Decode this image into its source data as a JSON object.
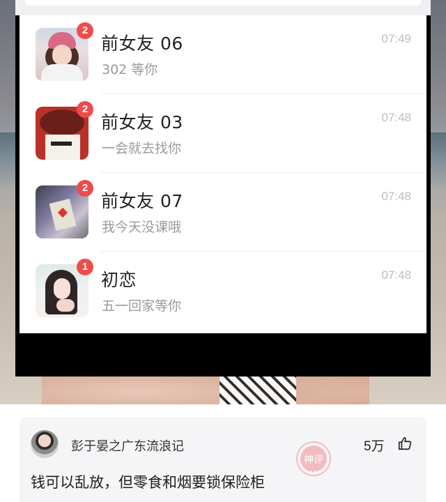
{
  "chat_list": {
    "items": [
      {
        "name": "前女友 06",
        "message": "302 等你",
        "time": "07:49",
        "unread": "2",
        "avatar_icon": "girl-pink-hat-avatar"
      },
      {
        "name": "前女友 03",
        "message": "一会就去找你",
        "time": "07:48",
        "unread": "2",
        "avatar_icon": "red-hat-avatar"
      },
      {
        "name": "前女友 07",
        "message": "我今天没课哦",
        "time": "07:48",
        "unread": "2",
        "avatar_icon": "card-heart-avatar"
      },
      {
        "name": "初恋",
        "message": "五一回家等你",
        "time": "07:48",
        "unread": "1",
        "avatar_icon": "long-hair-girl-avatar"
      }
    ]
  },
  "comment": {
    "username": "彭于晏之广东流浪记",
    "likes": "5万",
    "text": "钱可以乱放，但零食和烟要锁保险柜",
    "stamp_label": "神评"
  },
  "colors": {
    "badge": "#ef4b4b",
    "stamp": "#f08a96"
  }
}
